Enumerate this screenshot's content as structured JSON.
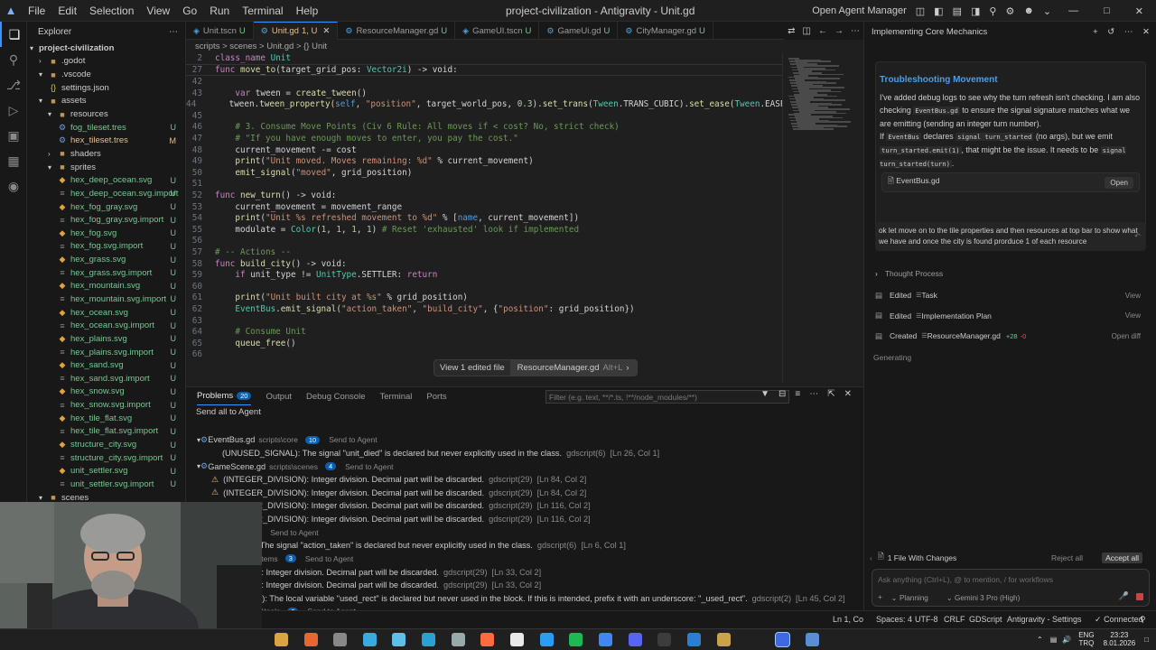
{
  "titlebar": {
    "menus": [
      "File",
      "Edit",
      "Selection",
      "View",
      "Go",
      "Run",
      "Terminal",
      "Help"
    ],
    "title": "project-civilization - Antigravity - Unit.gd",
    "open_agent_manager": "Open Agent Manager"
  },
  "explorer": {
    "title": "Explorer",
    "project": "project-civilization",
    "items": [
      {
        "label": ".godot",
        "depth": 1,
        "type": "folder",
        "open": false
      },
      {
        "label": ".vscode",
        "depth": 1,
        "type": "folder",
        "open": true
      },
      {
        "label": "settings.json",
        "depth": 2,
        "type": "file",
        "icon": "{}"
      },
      {
        "label": "assets",
        "depth": 1,
        "type": "folder",
        "open": true
      },
      {
        "label": "resources",
        "depth": 2,
        "type": "folder",
        "open": true
      },
      {
        "label": "fog_tileset.tres",
        "depth": 3,
        "type": "file",
        "status": "U"
      },
      {
        "label": "hex_tileset.tres",
        "depth": 3,
        "type": "file",
        "status": "M"
      },
      {
        "label": "shaders",
        "depth": 2,
        "type": "folder",
        "open": false
      },
      {
        "label": "sprites",
        "depth": 2,
        "type": "folder",
        "open": true
      },
      {
        "label": "hex_deep_ocean.svg",
        "depth": 3,
        "type": "file",
        "status": "U"
      },
      {
        "label": "hex_deep_ocean.svg.import",
        "depth": 3,
        "type": "file",
        "status": "U"
      },
      {
        "label": "hex_fog_gray.svg",
        "depth": 3,
        "type": "file",
        "status": "U"
      },
      {
        "label": "hex_fog_gray.svg.import",
        "depth": 3,
        "type": "file",
        "status": "U"
      },
      {
        "label": "hex_fog.svg",
        "depth": 3,
        "type": "file",
        "status": "U"
      },
      {
        "label": "hex_fog.svg.import",
        "depth": 3,
        "type": "file",
        "status": "U"
      },
      {
        "label": "hex_grass.svg",
        "depth": 3,
        "type": "file",
        "status": "U"
      },
      {
        "label": "hex_grass.svg.import",
        "depth": 3,
        "type": "file",
        "status": "U"
      },
      {
        "label": "hex_mountain.svg",
        "depth": 3,
        "type": "file",
        "status": "U"
      },
      {
        "label": "hex_mountain.svg.import",
        "depth": 3,
        "type": "file",
        "status": "U"
      },
      {
        "label": "hex_ocean.svg",
        "depth": 3,
        "type": "file",
        "status": "U"
      },
      {
        "label": "hex_ocean.svg.import",
        "depth": 3,
        "type": "file",
        "status": "U"
      },
      {
        "label": "hex_plains.svg",
        "depth": 3,
        "type": "file",
        "status": "U"
      },
      {
        "label": "hex_plains.svg.import",
        "depth": 3,
        "type": "file",
        "status": "U"
      },
      {
        "label": "hex_sand.svg",
        "depth": 3,
        "type": "file",
        "status": "U"
      },
      {
        "label": "hex_sand.svg.import",
        "depth": 3,
        "type": "file",
        "status": "U"
      },
      {
        "label": "hex_snow.svg",
        "depth": 3,
        "type": "file",
        "status": "U"
      },
      {
        "label": "hex_snow.svg.import",
        "depth": 3,
        "type": "file",
        "status": "U"
      },
      {
        "label": "hex_tile_flat.svg",
        "depth": 3,
        "type": "file",
        "status": "U"
      },
      {
        "label": "hex_tile_flat.svg.import",
        "depth": 3,
        "type": "file",
        "status": "U"
      },
      {
        "label": "structure_city.svg",
        "depth": 3,
        "type": "file",
        "status": "U"
      },
      {
        "label": "structure_city.svg.import",
        "depth": 3,
        "type": "file",
        "status": "U"
      },
      {
        "label": "unit_settler.svg",
        "depth": 3,
        "type": "file",
        "status": "U"
      },
      {
        "label": "unit_settler.svg.import",
        "depth": 3,
        "type": "file",
        "status": "U"
      },
      {
        "label": "scenes",
        "depth": 1,
        "type": "folder",
        "open": true
      }
    ]
  },
  "tabs": [
    {
      "label": "Unit.tscn",
      "mod": "U",
      "active": false
    },
    {
      "label": "Unit.gd",
      "mod": "1, U",
      "active": true
    },
    {
      "label": "ResourceManager.gd",
      "mod": "U",
      "active": false
    },
    {
      "label": "GameUI.tscn",
      "mod": "U",
      "active": false
    },
    {
      "label": "GameUi.gd",
      "mod": "U",
      "active": false
    },
    {
      "label": "CityManager.gd",
      "mod": "U",
      "active": false
    }
  ],
  "breadcrumb": "scripts > scenes > Unit.gd > {} Unit",
  "editor": {
    "lines": [
      {
        "n": "2",
        "text": "class_name Unit"
      },
      {
        "n": "27",
        "text": "func move_to(target_grid_pos: Vector2i) -> void:"
      },
      {
        "n": "42",
        "text": ""
      },
      {
        "n": "43",
        "text": "    var tween = create_tween()"
      },
      {
        "n": "44",
        "text": "    tween.tween_property(self, \"position\", target_world_pos, 0.3).set_trans(Tween.TRANS_CUBIC).set_ease(Tween.EASE_OUT)"
      },
      {
        "n": "45",
        "text": ""
      },
      {
        "n": "46",
        "text": "    # 3. Consume Move Points (Civ 6 Rule: All moves if < cost? No, strict check)"
      },
      {
        "n": "47",
        "text": "    # \"If you have enough moves to enter, you pay the cost.\""
      },
      {
        "n": "48",
        "text": "    current_movement -= cost"
      },
      {
        "n": "49",
        "text": "    print(\"Unit moved. Moves remaining: %d\" % current_movement)"
      },
      {
        "n": "50",
        "text": "    emit_signal(\"moved\", grid_position)"
      },
      {
        "n": "51",
        "text": ""
      },
      {
        "n": "52",
        "text": "func new_turn() -> void:"
      },
      {
        "n": "53",
        "text": "    current_movement = movement_range"
      },
      {
        "n": "54",
        "text": "    print(\"Unit %s refreshed movement to %d\" % [name, current_movement])"
      },
      {
        "n": "55",
        "text": "    modulate = Color(1, 1, 1, 1) # Reset 'exhausted' look if implemented"
      },
      {
        "n": "56",
        "text": ""
      },
      {
        "n": "57",
        "text": "# -- Actions --"
      },
      {
        "n": "58",
        "text": "func build_city() -> void:"
      },
      {
        "n": "59",
        "text": "    if unit_type != UnitType.SETTLER: return"
      },
      {
        "n": "60",
        "text": ""
      },
      {
        "n": "61",
        "text": "    print(\"Unit built city at %s\" % grid_position)"
      },
      {
        "n": "62",
        "text": "    EventBus.emit_signal(\"action_taken\", \"build_city\", {\"position\": grid_position})"
      },
      {
        "n": "63",
        "text": ""
      },
      {
        "n": "64",
        "text": "    # Consume Unit"
      },
      {
        "n": "65",
        "text": "    queue_free()"
      },
      {
        "n": "66",
        "text": ""
      }
    ],
    "view_edited_label": "View 1 edited file",
    "view_edited_file": "ResourceManager.gd",
    "view_edited_shortcut": "Alt+L"
  },
  "panel": {
    "tabs": [
      {
        "label": "Problems",
        "badge": "20",
        "active": true
      },
      {
        "label": "Output"
      },
      {
        "label": "Debug Console"
      },
      {
        "label": "Terminal"
      },
      {
        "label": "Ports"
      }
    ],
    "filter_placeholder": "Filter (e.g. text, **/*.ts, !**/node_modules/**)",
    "send_all": "Send all to Agent",
    "rows": [
      {
        "kind": "file",
        "text": "EventBus.gd",
        "path": "scripts\\core",
        "count": "10",
        "send": "Send to Agent"
      },
      {
        "kind": "msg",
        "text": "(UNUSED_SIGNAL): The signal \"unit_died\" is declared but never explicitly used in the class.",
        "src": "gdscript(6)",
        "loc": "[Ln 26, Col 1]"
      },
      {
        "kind": "file",
        "text": "GameScene.gd",
        "path": "scripts\\scenes",
        "count": "4",
        "send": "Send to Agent"
      },
      {
        "kind": "warn",
        "text": "(INTEGER_DIVISION): Integer division. Decimal part will be discarded.",
        "src": "gdscript(29)",
        "loc": "[Ln 84, Col 2]"
      },
      {
        "kind": "warn",
        "text": "(INTEGER_DIVISION): Integer division. Decimal part will be discarded.",
        "src": "gdscript(29)",
        "loc": "[Ln 84, Col 2]"
      },
      {
        "kind": "warn",
        "text": "(INTEGER_DIVISION): Integer division. Decimal part will be discarded.",
        "src": "gdscript(29)",
        "loc": "[Ln 116, Col 2]"
      },
      {
        "kind": "warn",
        "text": "(INTEGER_DIVISION): Integer division. Decimal part will be discarded.",
        "src": "gdscript(29)",
        "loc": "[Ln 116, Col 2]"
      },
      {
        "kind": "file",
        "text": "ts\\scenes",
        "path": "",
        "count": "1",
        "send": "Send to Agent"
      },
      {
        "kind": "msg",
        "text": "SIGNAL): The signal \"action_taken\" is declared but never explicitly used in the class.",
        "src": "gdscript(6)",
        "loc": "[Ln 6, Col 1]"
      },
      {
        "kind": "file",
        "text": "r.gd",
        "path": "scripts\\systems",
        "count": "3",
        "send": "Send to Agent"
      },
      {
        "kind": "msg",
        "text": "DIVISION): Integer division. Decimal part will be discarded.",
        "src": "gdscript(29)",
        "loc": "[Ln 33, Col 2]"
      },
      {
        "kind": "msg",
        "text": "DIVISION): Integer division. Decimal part will be discarded.",
        "src": "gdscript(29)",
        "loc": "[Ln 33, Col 2]"
      },
      {
        "kind": "msg",
        "text": "VARIABLE): The local variable \"used_rect\" is declared but never used in the block. If this is intended, prefix it with an underscore: \"_used_rect\".",
        "src": "gdscript(2)",
        "loc": "[Ln 45, Col 2]"
      },
      {
        "kind": "file",
        "text": "rator.gd",
        "path": "scripts\\tools",
        "count": "2",
        "send": "Send to Agent"
      },
      {
        "kind": "msg",
        "text": "PARAMETER): The parameter \"color\" is never used in the function \"generate_hex_texture()\". If this is intended, prefix it with an underscore: \"_color\".",
        "src": "gdscript(5)",
        "loc": "[Ln 4, Col 1]"
      }
    ]
  },
  "agent": {
    "header_title": "Implementing Core Mechanics",
    "card_title": "Troubleshooting Movement",
    "card_body_1": "I've added debug logs to see why the turn refresh isn't checking. I am also checking",
    "code_eventbus": "EventBus.gd",
    "card_body_2": "to ensure the signal signature matches what we are emitting (sending an integer turn number).",
    "card_body_3": "If",
    "code_eventbus2": "EventBus",
    "card_body_4": "declares",
    "code_signal": "signal turn_started",
    "card_body_5": "(no args), but we emit",
    "code_emit": "turn_started.emit(1)",
    "card_body_6": ", that might be the issue. It needs to be",
    "code_signal2": "signal turn_started(turn)",
    "card_file": "EventBus.gd",
    "card_open": "Open",
    "user_message": "ok let move on to the tile properties and then resources at top bar to show what we have and once the city is found prorduce 1 of each resource",
    "thought": "Thought Process",
    "actions": [
      {
        "verb": "Edited",
        "target": "Task",
        "right": "View"
      },
      {
        "verb": "Edited",
        "target": "Implementation Plan",
        "right": "View"
      },
      {
        "verb": "Created",
        "target": "ResourceManager.gd",
        "diff_add": "+28",
        "diff_del": "-0",
        "right": "Open diff"
      }
    ],
    "generating": "Generating",
    "changes": "1 File With Changes",
    "reject_all": "Reject all",
    "accept_all": "Accept all",
    "input_placeholder": "Ask anything (Ctrl+L), @ to mention, / for workflows",
    "mode": "Planning",
    "model": "Gemini 3 Pro (High)"
  },
  "statusbar": {
    "position": "Ln 1, Col 1",
    "spaces": "Spaces: 4",
    "encoding": "UTF-8",
    "eol": "CRLF",
    "language": "GDScript",
    "settings": "Antigravity - Settings",
    "connection": "Connected"
  },
  "taskbar": {
    "lang": "ENG",
    "lang2": "TRQ",
    "time": "23:23",
    "date": "8.01.2026"
  },
  "colors": {
    "accent": "#3794ff",
    "warning": "#e5c07b",
    "untracked": "#73c991",
    "modified": "#e2c08d"
  }
}
